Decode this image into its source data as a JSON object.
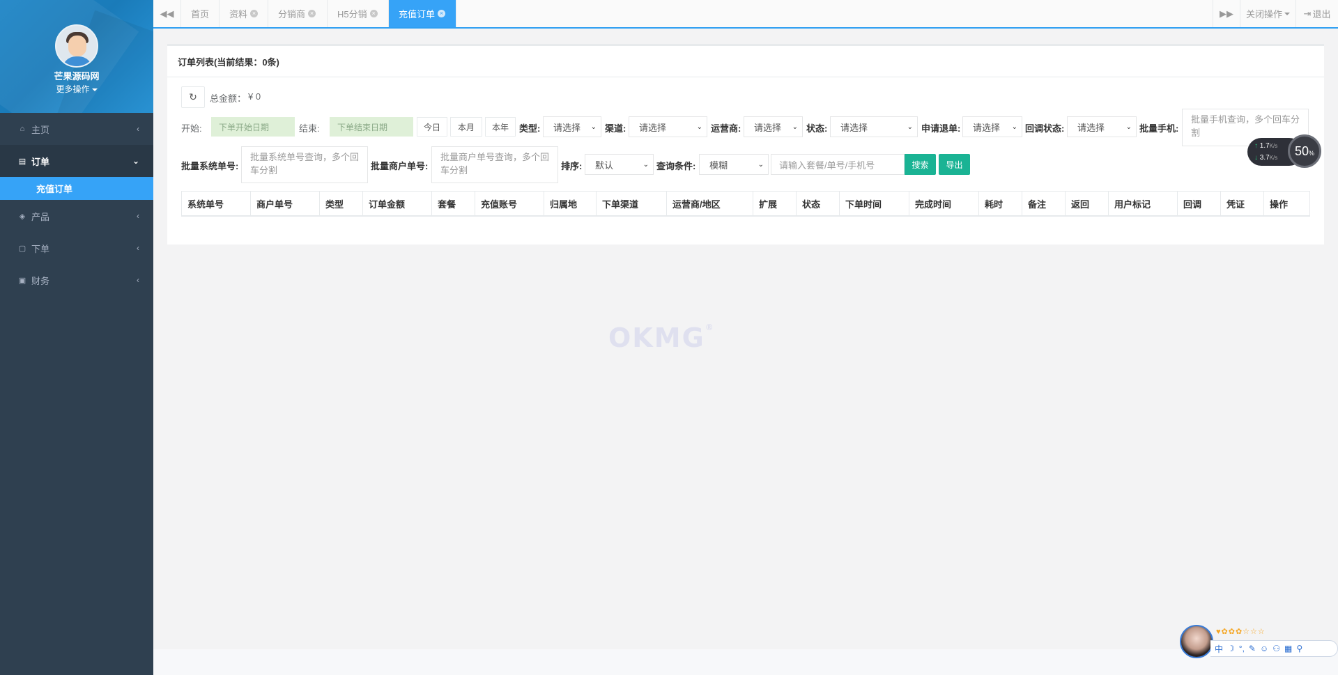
{
  "sidebar": {
    "profile_name": "芒果源码网",
    "profile_more": "更多操作",
    "items": [
      {
        "label": "主页",
        "icon": "home-icon"
      },
      {
        "label": "订单",
        "icon": "document-icon"
      },
      {
        "label": "产品",
        "icon": "cube-icon"
      },
      {
        "label": "下单",
        "icon": "file-icon"
      },
      {
        "label": "财务",
        "icon": "money-icon"
      }
    ],
    "sub_item": "充值订单"
  },
  "tabs": [
    {
      "label": "首页"
    },
    {
      "label": "资料"
    },
    {
      "label": "分销商"
    },
    {
      "label": "H5分销"
    },
    {
      "label": "充值订单"
    }
  ],
  "topbar": {
    "close_ops": "关闭操作",
    "logout": "退出"
  },
  "panel": {
    "title": "订单列表(当前结果：0条)",
    "total_label": "总金额：",
    "total_value": "¥ 0"
  },
  "filters": {
    "start_label": "开始:",
    "start_placeholder": "下单开始日期",
    "end_label": "结束:",
    "end_placeholder": "下单结束日期",
    "today": "今日",
    "month": "本月",
    "year": "本年",
    "type_label": "类型:",
    "channel_label": "渠道:",
    "operator_label": "运营商:",
    "status_label": "状态:",
    "refund_label": "申请退单:",
    "callback_label": "回调状态:",
    "batch_phone_label": "批量手机:",
    "batch_phone_placeholder": "批量手机查询，多个回车分割",
    "select_placeholder": "请选择",
    "batch_sys_label": "批量系统单号:",
    "batch_sys_placeholder": "批量系统单号查询，多个回车分割",
    "batch_merchant_label": "批量商户单号:",
    "batch_merchant_placeholder": "批量商户单号查询，多个回车分割",
    "sort_label": "排序:",
    "sort_value": "默认",
    "query_label": "查询条件:",
    "query_value": "模糊",
    "search_placeholder": "请输入套餐/单号/手机号",
    "search_btn": "搜索",
    "export_btn": "导出"
  },
  "table": {
    "columns": [
      "系统单号",
      "商户单号",
      "类型",
      "订单金额",
      "套餐",
      "充值账号",
      "归属地",
      "下单渠道",
      "运营商/地区",
      "扩展",
      "状态",
      "下单时间",
      "完成时间",
      "耗时",
      "备注",
      "返回",
      "用户标记",
      "回调",
      "凭证",
      "操作"
    ]
  },
  "watermark": "OKMG",
  "speed_widget": {
    "up": "1.7",
    "down": "3.7",
    "unit": "K/s",
    "percent": "50",
    "percent_sign": "%"
  },
  "ime": {
    "chars": [
      "中",
      "☽",
      "°,",
      "✎",
      "☺",
      "⚇",
      "▦",
      "⚲"
    ]
  },
  "colors": {
    "sidebar_bg": "#2f4050",
    "accent": "#36a3f7",
    "success": "#1ab394"
  }
}
